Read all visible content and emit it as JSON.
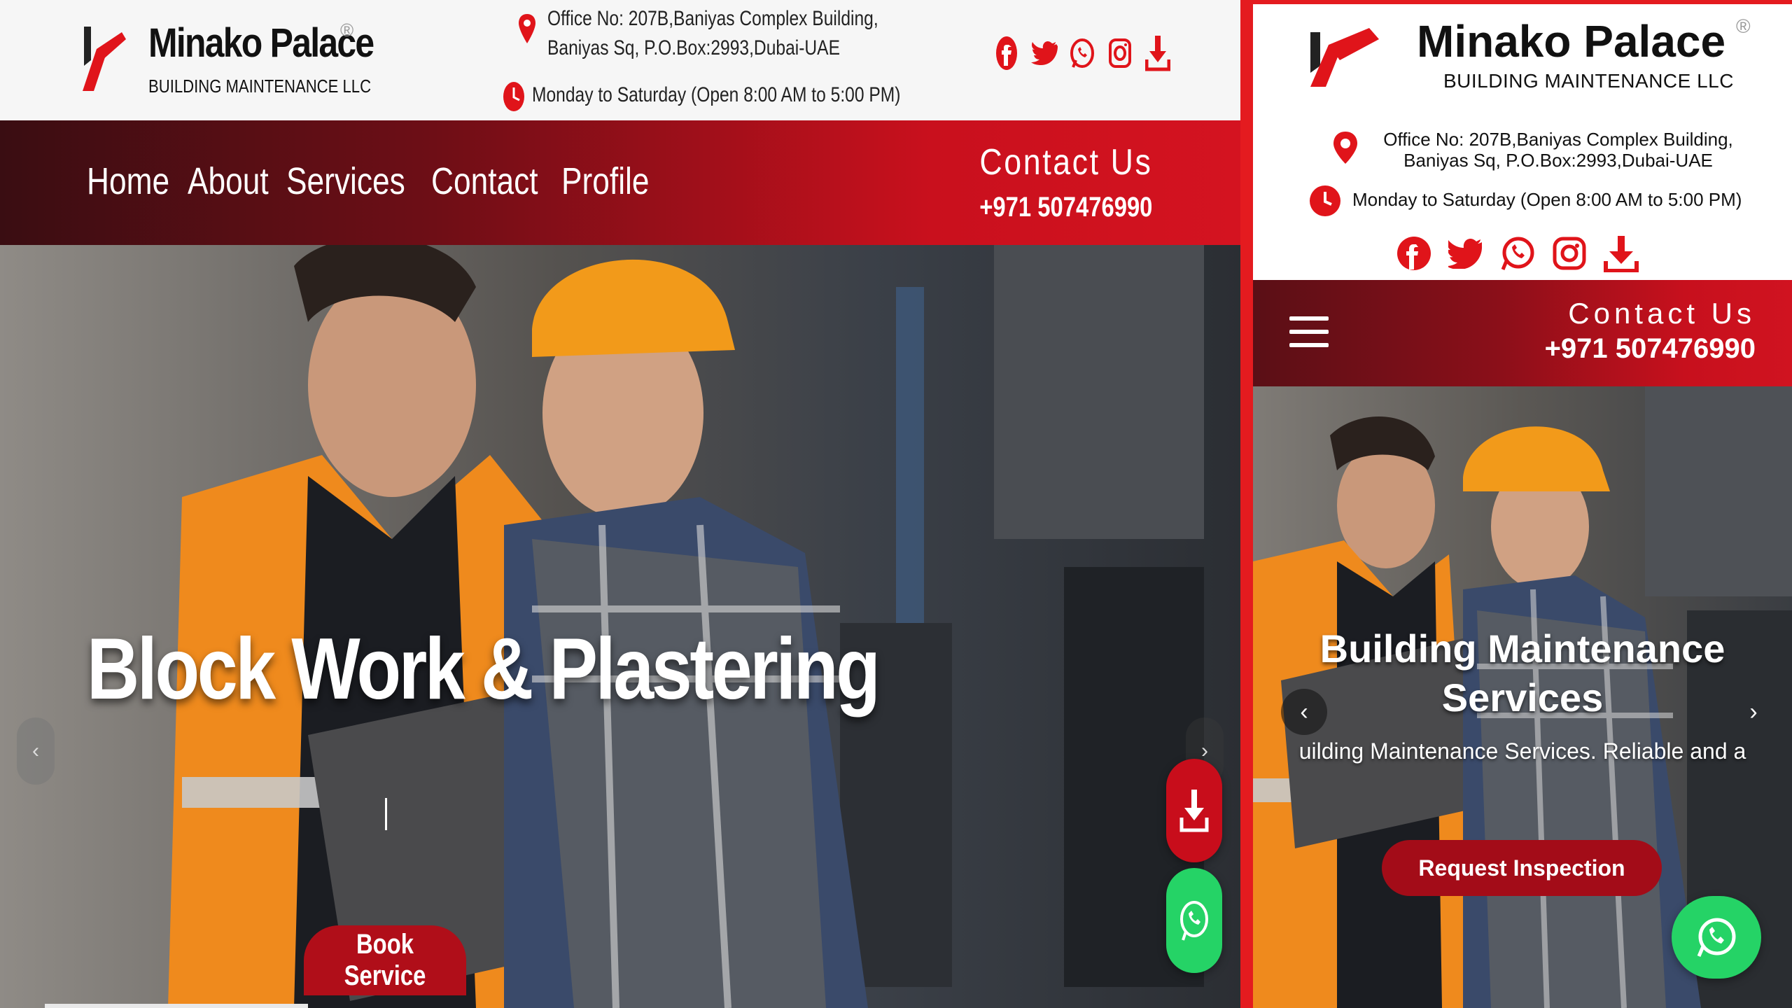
{
  "brand": {
    "name": "Minako Palace",
    "registered_mark": "®",
    "tagline": "BUILDING MAINTENANCE LLC"
  },
  "contact_info": {
    "address_line1": "Office No: 207B,Baniyas Complex Building,",
    "address_line2": "Baniyas Sq, P.O.Box:2993,Dubai-UAE",
    "hours": "Monday to Saturday (Open 8:00 AM to 5:00 PM)"
  },
  "social": [
    {
      "icon": "facebook-icon"
    },
    {
      "icon": "twitter-icon"
    },
    {
      "icon": "whatsapp-icon"
    },
    {
      "icon": "instagram-icon"
    },
    {
      "icon": "download-icon"
    }
  ],
  "desktop": {
    "nav": [
      "Home",
      "About",
      "Services",
      "Contact",
      "Profile"
    ],
    "contact_label": "Contact Us",
    "phone": "+971 507476990",
    "hero_title": "Block Work & Plastering",
    "cta": "Book Service",
    "prev_arrow": "‹",
    "next_arrow": "›"
  },
  "mobile": {
    "contact_label": "Contact Us",
    "phone": "+971 507476990",
    "hero_title": "Building Maintenance Services",
    "hero_desc": "uilding Maintenance Services. Reliable and a",
    "cta": "Request Inspection",
    "prev_arrow": "‹",
    "next_arrow": "›"
  },
  "colors": {
    "brand_red": "#e0141a",
    "nav_dark": "#3a0d12",
    "whatsapp_green": "#25d366"
  }
}
